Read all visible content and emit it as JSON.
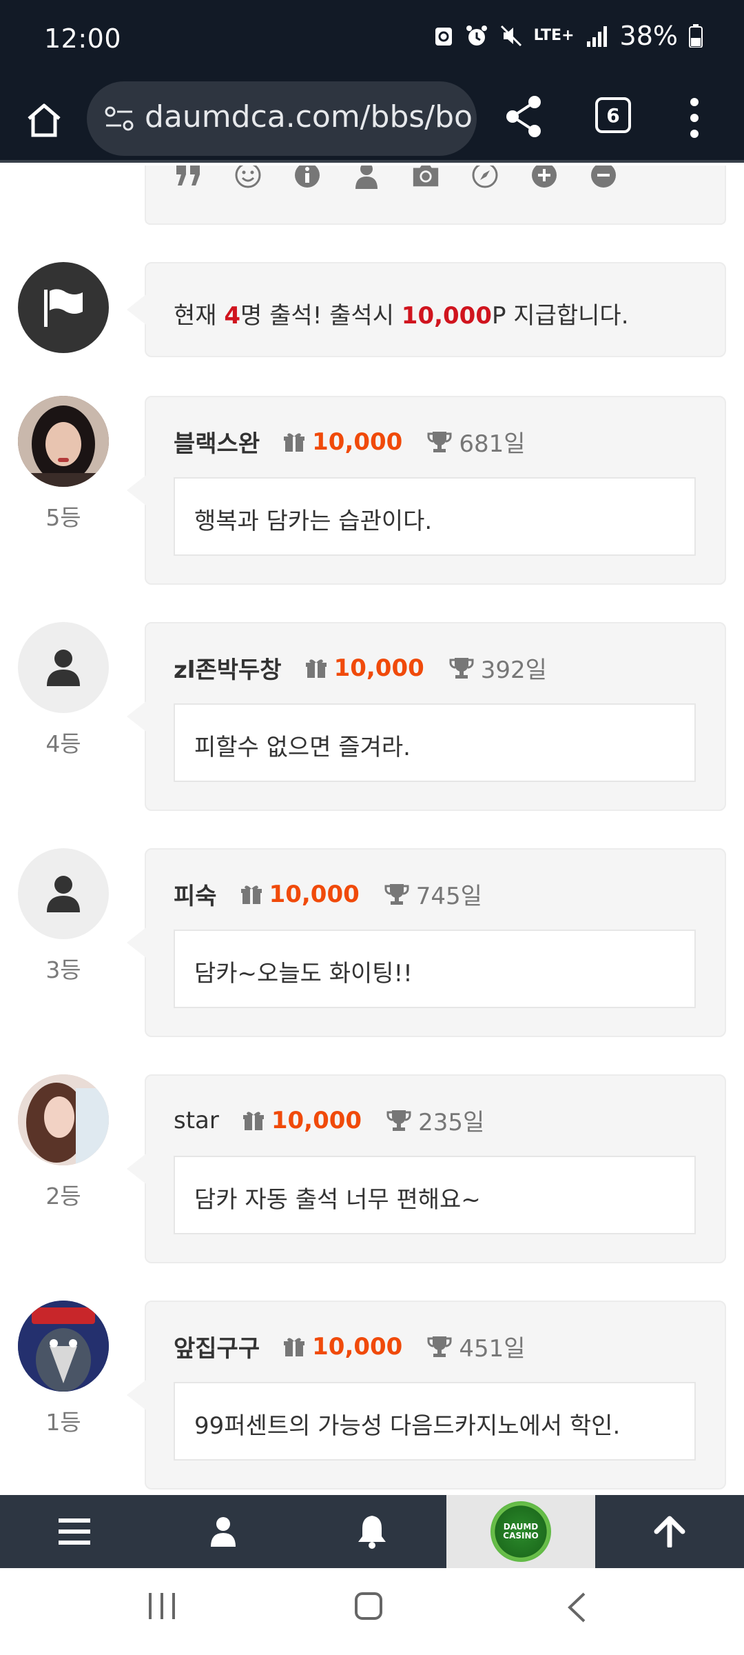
{
  "status_bar": {
    "time": "12:00",
    "network": "LTE+",
    "battery": "38%"
  },
  "browser": {
    "url": "daumdca.com/bbs/bo",
    "tab_count": "6"
  },
  "attendance_notice": {
    "prefix": "현재 ",
    "count": "4",
    "middle": "명 출석! 출석시 ",
    "points": "10,000",
    "suffix": "P 지급합니다."
  },
  "entries": [
    {
      "rank": "5등",
      "nickname": "블랙스완",
      "points": "10,000",
      "days": "681일",
      "message": "행복과 담카는 습관이다.",
      "avatar": "photo"
    },
    {
      "rank": "4등",
      "nickname": "zl존박두창",
      "points": "10,000",
      "days": "392일",
      "message": "피할수 없으면 즐겨라.",
      "avatar": "default"
    },
    {
      "rank": "3등",
      "nickname": "피숙",
      "points": "10,000",
      "days": "745일",
      "message": "담카~오늘도 화이팅!!",
      "avatar": "default"
    },
    {
      "rank": "2등",
      "nickname": "star",
      "points": "10,000",
      "days": "235일",
      "message": "담카 자동 출석 너무 편해요~",
      "avatar": "photo"
    },
    {
      "rank": "1등",
      "nickname": "앞집구구",
      "points": "10,000",
      "days": "451일",
      "message": "99퍼센트의 가능성 다음드카지노에서 학인.",
      "avatar": "photo"
    }
  ],
  "bottom_nav": {
    "logo_text_line1": "DAUMD",
    "logo_text_line2": "CASINO"
  },
  "colors": {
    "accent_red": "#d0141e",
    "points_orange": "#f04a0a",
    "nav_dark": "#2d3642",
    "status_dark": "#121a26"
  }
}
